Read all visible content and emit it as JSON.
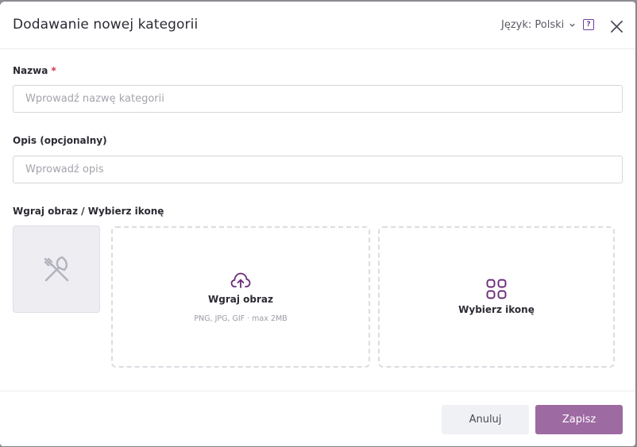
{
  "dialog": {
    "title": "Dodawanie nowej kategorii",
    "language_label": "Język: Polski"
  },
  "form": {
    "name": {
      "label": "Nazwa",
      "required_mark": "*",
      "placeholder": "Wprowadź nazwę kategorii",
      "value": ""
    },
    "description": {
      "label": "Opis (opcjonalny)",
      "placeholder": "Wprowadź opis",
      "value": ""
    },
    "media": {
      "label": "Wgraj obraz / Wybierz ikonę",
      "preview_icon": "fork-knife-icon",
      "upload": {
        "title": "Wgraj obraz",
        "hint": "PNG, JPG, GIF · max 2MB",
        "icon": "cloud-upload-icon"
      },
      "pick_icon": {
        "title": "Wybierz ikonę",
        "icon": "grid-icon"
      }
    }
  },
  "footer": {
    "cancel_label": "Anuluj",
    "save_label": "Zapisz"
  },
  "colors": {
    "accent": "#6b3fa0",
    "save_button": "#9d6aa2",
    "required": "#d0364b"
  }
}
